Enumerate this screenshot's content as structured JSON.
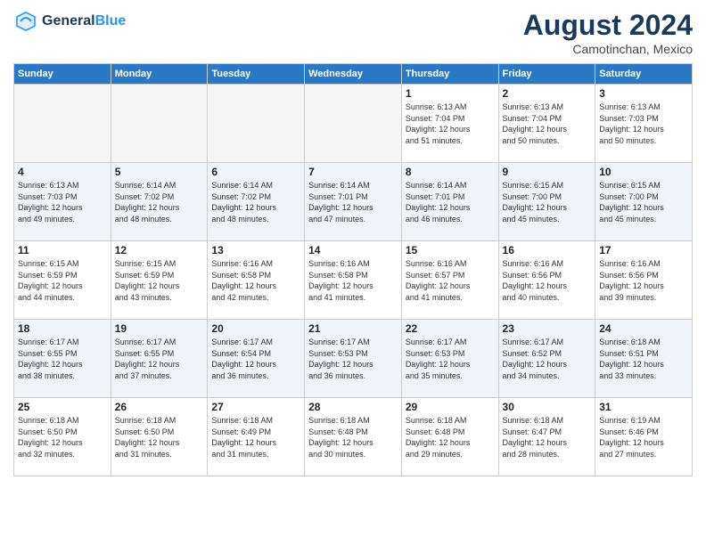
{
  "header": {
    "logo_line1": "General",
    "logo_line2": "Blue",
    "title": "August 2024",
    "subtitle": "Camotinchan, Mexico"
  },
  "weekdays": [
    "Sunday",
    "Monday",
    "Tuesday",
    "Wednesday",
    "Thursday",
    "Friday",
    "Saturday"
  ],
  "weeks": [
    [
      {
        "day": "",
        "info": "",
        "empty": true
      },
      {
        "day": "",
        "info": "",
        "empty": true
      },
      {
        "day": "",
        "info": "",
        "empty": true
      },
      {
        "day": "",
        "info": "",
        "empty": true
      },
      {
        "day": "1",
        "info": "Sunrise: 6:13 AM\nSunset: 7:04 PM\nDaylight: 12 hours\nand 51 minutes.",
        "empty": false
      },
      {
        "day": "2",
        "info": "Sunrise: 6:13 AM\nSunset: 7:04 PM\nDaylight: 12 hours\nand 50 minutes.",
        "empty": false
      },
      {
        "day": "3",
        "info": "Sunrise: 6:13 AM\nSunset: 7:03 PM\nDaylight: 12 hours\nand 50 minutes.",
        "empty": false
      }
    ],
    [
      {
        "day": "4",
        "info": "Sunrise: 6:13 AM\nSunset: 7:03 PM\nDaylight: 12 hours\nand 49 minutes.",
        "empty": false
      },
      {
        "day": "5",
        "info": "Sunrise: 6:14 AM\nSunset: 7:02 PM\nDaylight: 12 hours\nand 48 minutes.",
        "empty": false
      },
      {
        "day": "6",
        "info": "Sunrise: 6:14 AM\nSunset: 7:02 PM\nDaylight: 12 hours\nand 48 minutes.",
        "empty": false
      },
      {
        "day": "7",
        "info": "Sunrise: 6:14 AM\nSunset: 7:01 PM\nDaylight: 12 hours\nand 47 minutes.",
        "empty": false
      },
      {
        "day": "8",
        "info": "Sunrise: 6:14 AM\nSunset: 7:01 PM\nDaylight: 12 hours\nand 46 minutes.",
        "empty": false
      },
      {
        "day": "9",
        "info": "Sunrise: 6:15 AM\nSunset: 7:00 PM\nDaylight: 12 hours\nand 45 minutes.",
        "empty": false
      },
      {
        "day": "10",
        "info": "Sunrise: 6:15 AM\nSunset: 7:00 PM\nDaylight: 12 hours\nand 45 minutes.",
        "empty": false
      }
    ],
    [
      {
        "day": "11",
        "info": "Sunrise: 6:15 AM\nSunset: 6:59 PM\nDaylight: 12 hours\nand 44 minutes.",
        "empty": false
      },
      {
        "day": "12",
        "info": "Sunrise: 6:15 AM\nSunset: 6:59 PM\nDaylight: 12 hours\nand 43 minutes.",
        "empty": false
      },
      {
        "day": "13",
        "info": "Sunrise: 6:16 AM\nSunset: 6:58 PM\nDaylight: 12 hours\nand 42 minutes.",
        "empty": false
      },
      {
        "day": "14",
        "info": "Sunrise: 6:16 AM\nSunset: 6:58 PM\nDaylight: 12 hours\nand 41 minutes.",
        "empty": false
      },
      {
        "day": "15",
        "info": "Sunrise: 6:16 AM\nSunset: 6:57 PM\nDaylight: 12 hours\nand 41 minutes.",
        "empty": false
      },
      {
        "day": "16",
        "info": "Sunrise: 6:16 AM\nSunset: 6:56 PM\nDaylight: 12 hours\nand 40 minutes.",
        "empty": false
      },
      {
        "day": "17",
        "info": "Sunrise: 6:16 AM\nSunset: 6:56 PM\nDaylight: 12 hours\nand 39 minutes.",
        "empty": false
      }
    ],
    [
      {
        "day": "18",
        "info": "Sunrise: 6:17 AM\nSunset: 6:55 PM\nDaylight: 12 hours\nand 38 minutes.",
        "empty": false
      },
      {
        "day": "19",
        "info": "Sunrise: 6:17 AM\nSunset: 6:55 PM\nDaylight: 12 hours\nand 37 minutes.",
        "empty": false
      },
      {
        "day": "20",
        "info": "Sunrise: 6:17 AM\nSunset: 6:54 PM\nDaylight: 12 hours\nand 36 minutes.",
        "empty": false
      },
      {
        "day": "21",
        "info": "Sunrise: 6:17 AM\nSunset: 6:53 PM\nDaylight: 12 hours\nand 36 minutes.",
        "empty": false
      },
      {
        "day": "22",
        "info": "Sunrise: 6:17 AM\nSunset: 6:53 PM\nDaylight: 12 hours\nand 35 minutes.",
        "empty": false
      },
      {
        "day": "23",
        "info": "Sunrise: 6:17 AM\nSunset: 6:52 PM\nDaylight: 12 hours\nand 34 minutes.",
        "empty": false
      },
      {
        "day": "24",
        "info": "Sunrise: 6:18 AM\nSunset: 6:51 PM\nDaylight: 12 hours\nand 33 minutes.",
        "empty": false
      }
    ],
    [
      {
        "day": "25",
        "info": "Sunrise: 6:18 AM\nSunset: 6:50 PM\nDaylight: 12 hours\nand 32 minutes.",
        "empty": false
      },
      {
        "day": "26",
        "info": "Sunrise: 6:18 AM\nSunset: 6:50 PM\nDaylight: 12 hours\nand 31 minutes.",
        "empty": false
      },
      {
        "day": "27",
        "info": "Sunrise: 6:18 AM\nSunset: 6:49 PM\nDaylight: 12 hours\nand 31 minutes.",
        "empty": false
      },
      {
        "day": "28",
        "info": "Sunrise: 6:18 AM\nSunset: 6:48 PM\nDaylight: 12 hours\nand 30 minutes.",
        "empty": false
      },
      {
        "day": "29",
        "info": "Sunrise: 6:18 AM\nSunset: 6:48 PM\nDaylight: 12 hours\nand 29 minutes.",
        "empty": false
      },
      {
        "day": "30",
        "info": "Sunrise: 6:18 AM\nSunset: 6:47 PM\nDaylight: 12 hours\nand 28 minutes.",
        "empty": false
      },
      {
        "day": "31",
        "info": "Sunrise: 6:19 AM\nSunset: 6:46 PM\nDaylight: 12 hours\nand 27 minutes.",
        "empty": false
      }
    ]
  ]
}
